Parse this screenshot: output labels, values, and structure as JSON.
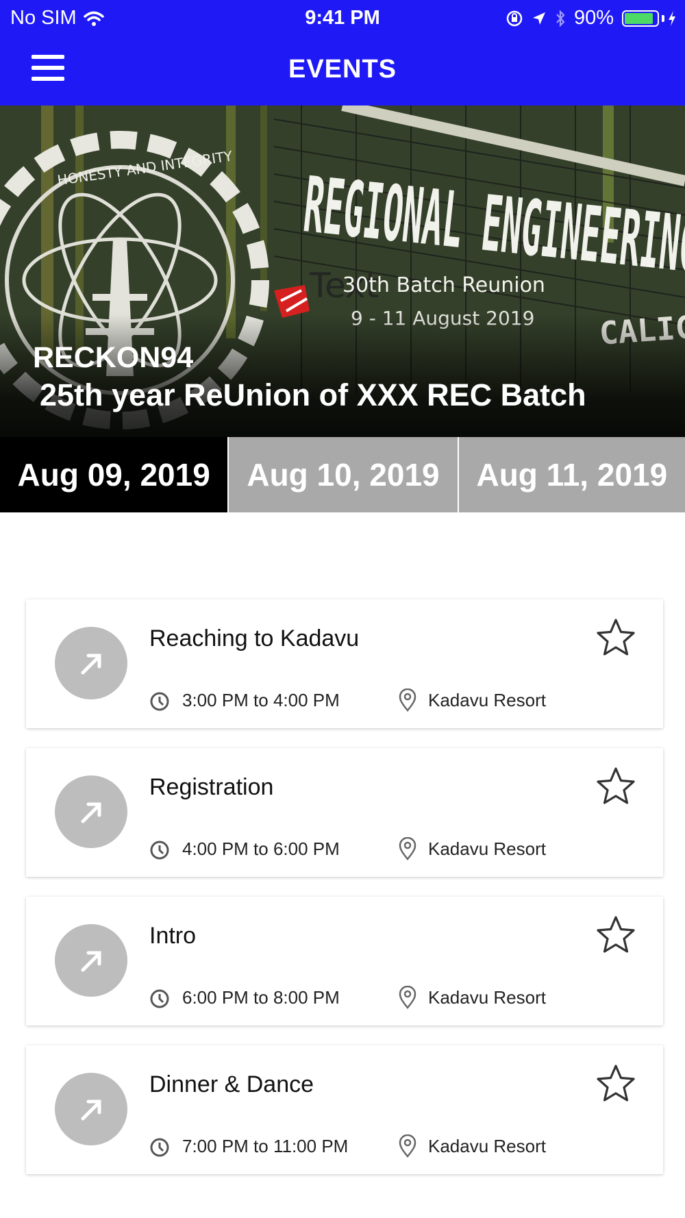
{
  "status_bar": {
    "carrier": "No SIM",
    "time": "9:41 PM",
    "battery_percent": "90%",
    "battery_level": 0.9
  },
  "header": {
    "title": "EVENTS",
    "menu_icon": "hamburger-menu-icon"
  },
  "hero": {
    "title": "RECKON94",
    "subtitle": "25th year ReUnion of XXX REC Batch",
    "image_text": {
      "sign": "REGIONAL ENGINEERING",
      "city": "CALICUT",
      "seal_motto": "HONESTY AND INTEGRITY",
      "tag": "Text",
      "caption": "30th Batch Reunion",
      "dates": "9 - 11 August 2019"
    }
  },
  "date_tabs": [
    {
      "label": "Aug 09, 2019",
      "active": true
    },
    {
      "label": "Aug 10, 2019",
      "active": false
    },
    {
      "label": "Aug 11, 2019",
      "active": false
    }
  ],
  "events": [
    {
      "title": "Reaching to Kadavu",
      "time": "3:00 PM to 4:00 PM",
      "location": "Kadavu Resort"
    },
    {
      "title": "Registration",
      "time": "4:00 PM to 6:00 PM",
      "location": "Kadavu Resort"
    },
    {
      "title": "Intro",
      "time": "6:00 PM to 8:00 PM",
      "location": "Kadavu Resort"
    },
    {
      "title": "Dinner & Dance",
      "time": "7:00 PM to 11:00 PM",
      "location": "Kadavu Resort"
    }
  ],
  "colors": {
    "header_blue": "#1f1af5",
    "active_tab": "#000000",
    "inactive_tab": "#a9a9a9",
    "event_icon_bg": "#bdbdbd"
  }
}
